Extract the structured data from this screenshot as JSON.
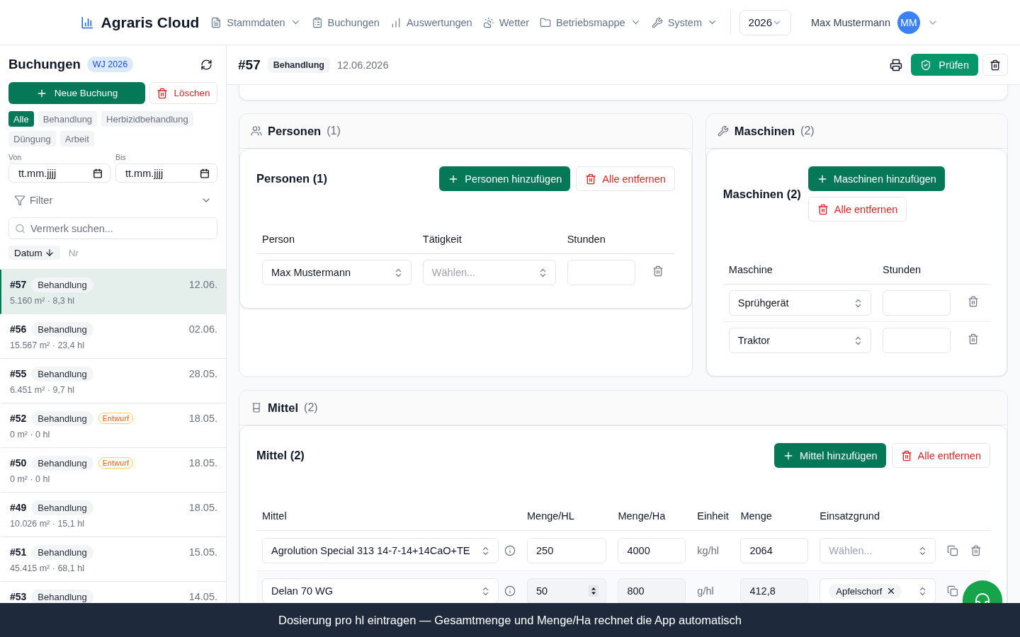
{
  "nav": {
    "brand": "Agraris Cloud",
    "items": [
      {
        "label": "Stammdaten",
        "dropdown": true
      },
      {
        "label": "Buchungen",
        "dropdown": false
      },
      {
        "label": "Auswertungen",
        "dropdown": false
      },
      {
        "label": "Wetter",
        "dropdown": false
      },
      {
        "label": "Betriebsmappe",
        "dropdown": true
      },
      {
        "label": "System",
        "dropdown": true
      }
    ],
    "year": "2026",
    "user": {
      "name": "Max Mustermann",
      "initials": "MM"
    }
  },
  "sidebar": {
    "title": "Buchungen",
    "badge": "WJ 2026",
    "new_button": "Neue Buchung",
    "delete_button": "Löschen",
    "type_filters": [
      {
        "label": "Alle",
        "selected": true
      },
      {
        "label": "Behandlung",
        "selected": false
      },
      {
        "label": "Herbizidbehandlung",
        "selected": false
      },
      {
        "label": "Düngung",
        "selected": false
      },
      {
        "label": "Arbeit",
        "selected": false
      }
    ],
    "date_from": {
      "label": "Von",
      "placeholder": "tt.mm.jjjj"
    },
    "date_to": {
      "label": "Bis",
      "placeholder": "tt.mm.jjjj"
    },
    "filter": {
      "label": "Filter",
      "expanded": false
    },
    "search": {
      "placeholder": "Vermerk suchen..."
    },
    "sort": [
      {
        "label": "Datum",
        "selected": true
      },
      {
        "label": "Nr",
        "selected": false
      }
    ],
    "bookings": [
      {
        "number": "#57",
        "type": "Behandlung",
        "date": "12.06.",
        "summary": "5.160 m² · 8,3 hl",
        "selected": true
      },
      {
        "number": "#56",
        "type": "Behandlung",
        "date": "02.06.",
        "summary": "15.567 m² · 23,4 hl",
        "selected": false
      },
      {
        "number": "#55",
        "type": "Behandlung",
        "date": "28.05.",
        "summary": "6.451 m² · 9,7 hl",
        "selected": false
      },
      {
        "number": "#52",
        "type": "Behandlung",
        "status": "Entwurf",
        "date": "18.05.",
        "summary": "0 m² · 0 hl",
        "selected": false
      },
      {
        "number": "#50",
        "type": "Behandlung",
        "status": "Entwurf",
        "date": "18.05.",
        "summary": "0 m² · 0 hl",
        "selected": false
      },
      {
        "number": "#49",
        "type": "Behandlung",
        "date": "18.05.",
        "summary": "10.026 m² · 15,1 hl",
        "selected": false
      },
      {
        "number": "#51",
        "type": "Behandlung",
        "date": "15.05.",
        "summary": "45.415 m² · 68,1 hl",
        "selected": false
      },
      {
        "number": "#53",
        "type": "Behandlung",
        "date": "14.05.",
        "selected": false
      }
    ]
  },
  "booking": {
    "number": "#57",
    "type": "Behandlung",
    "date": "12.06.2026",
    "check_button": "Prüfen"
  },
  "personen": {
    "title": "Personen",
    "count": "(1)",
    "heading": "Personen (1)",
    "add_button": "Personen hinzufügen",
    "clear_button": "Alle entfernen",
    "columns": [
      "Person",
      "Tätigkeit",
      "Stunden"
    ],
    "rows": [
      {
        "person": "Max Mustermann",
        "activity": {
          "placeholder": "Wählen..."
        }
      }
    ]
  },
  "maschinen": {
    "title": "Maschinen",
    "count": "(2)",
    "heading": "Maschinen (2)",
    "add_button": "Maschinen hinzufügen",
    "clear_button": "Alle entfernen",
    "columns": [
      "Maschine",
      "Stunden"
    ],
    "rows": [
      {
        "machine": "Sprühgerät"
      },
      {
        "machine": "Traktor"
      }
    ]
  },
  "mittel": {
    "title": "Mittel",
    "count": "(2)",
    "heading": "Mittel (2)",
    "add_button": "Mittel hinzufügen",
    "clear_button": "Alle entfernen",
    "columns": [
      "Mittel",
      "Menge/HL",
      "Menge/Ha",
      "Einheit",
      "Menge",
      "Einsatzgrund"
    ],
    "rows": [
      {
        "product": "Agrolution Special 313 14-7-14+14CaO+TE",
        "per_hl": {
          "value": "250",
          "stepper": false
        },
        "per_ha": "4000",
        "unit": "kg/hl",
        "amount": "2064",
        "reason": {
          "placeholder": "Wählen..."
        },
        "highlighted": false,
        "delete_icon": true
      },
      {
        "product": "Delan 70 WG",
        "per_hl": {
          "value": "50",
          "stepper": true
        },
        "per_ha": "800",
        "unit": "g/hl",
        "amount": "412,8",
        "reason": {
          "tags": [
            "Apfelschorf"
          ]
        },
        "highlighted": true,
        "delete_icon": false
      }
    ]
  },
  "hint": "Dosierung pro hl eintragen — Gesamtmenge und Menge/Ha rechnet die App automatisch"
}
